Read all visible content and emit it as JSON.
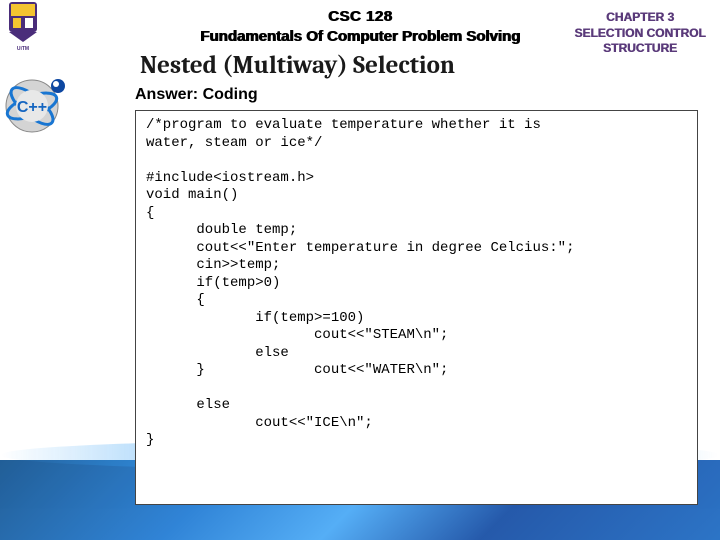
{
  "header": {
    "course_code": "CSC 128",
    "course_name": "Fundamentals Of Computer Problem Solving",
    "chapter_line1": "CHAPTER 3",
    "chapter_line2": "SELECTION CONTROL",
    "chapter_line3": "STRUCTURE"
  },
  "section_title": "Nested (Multiway) Selection",
  "answer_label": "Answer: Coding",
  "code": "/*program to evaluate temperature whether it is\nwater, steam or ice*/\n\n#include<iostream.h>\nvoid main()\n{\n      double temp;\n      cout<<\"Enter temperature in degree Celcius:\";\n      cin>>temp;\n      if(temp>0)\n      {\n             if(temp>=100)\n                    cout<<\"STEAM\\n\";\n             else\n      }             cout<<\"WATER\\n\";\n\n      else\n             cout<<\"ICE\\n\";\n}",
  "icons": {
    "uni_logo": "university-crest",
    "cpp_logo": "cpp-logo"
  }
}
